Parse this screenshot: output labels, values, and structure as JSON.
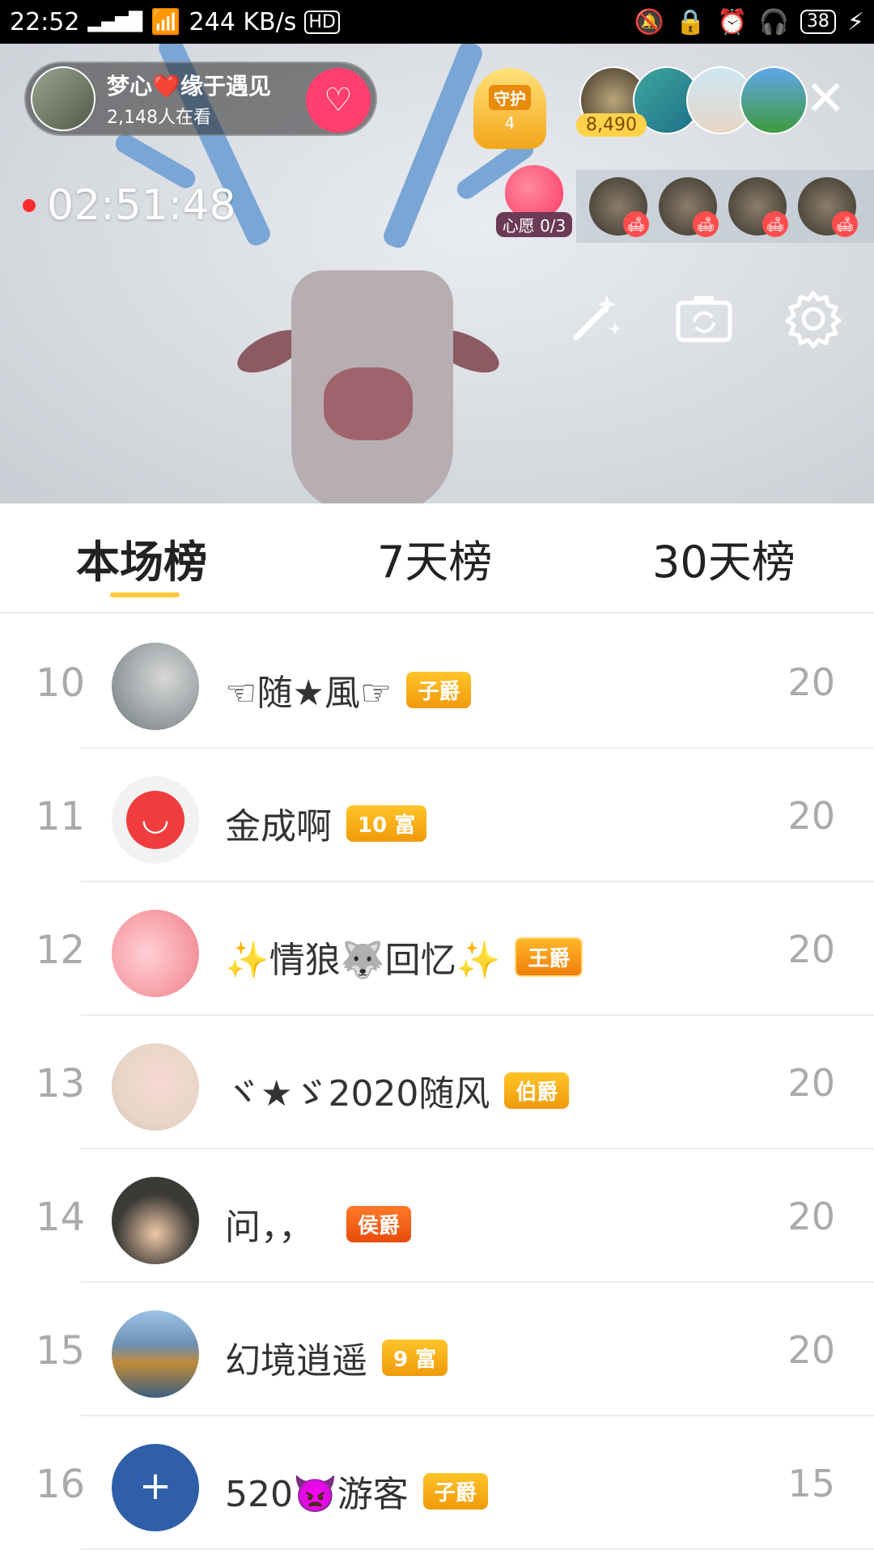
{
  "status_bar": {
    "time": "22:52",
    "network": "4G",
    "speed": "244 KB/s",
    "hd": "HD",
    "battery": "38"
  },
  "live": {
    "host_name": "梦心❤️缘于遇见",
    "viewers": "2,148人在看",
    "guard_label": "守护",
    "guard_count": "4",
    "audience_score": "8,490",
    "timer": "02:51:48",
    "wish_label": "心愿 0/3"
  },
  "tabs": [
    {
      "label": "本场榜",
      "active": true
    },
    {
      "label": "7天榜",
      "active": false
    },
    {
      "label": "30天榜",
      "active": false
    }
  ],
  "ranking": [
    {
      "rank": "10",
      "name": "☜随★風☞",
      "badge": "子爵",
      "score": "20",
      "avatar_color": "#6f7a7e"
    },
    {
      "rank": "11",
      "name": "金成啊",
      "badge": "10 富",
      "score": "20",
      "avatar_color": "#f03c3c"
    },
    {
      "rank": "12",
      "name": "✨情狼🐺回忆✨",
      "badge": "王爵",
      "score": "20",
      "avatar_color": "#f7a0a8"
    },
    {
      "rank": "13",
      "name": "ヾ★ゞ2020随风",
      "badge": "伯爵",
      "score": "20",
      "avatar_color": "#e8d6c8"
    },
    {
      "rank": "14",
      "name": "问，，",
      "badge": "侯爵",
      "score": "20",
      "avatar_color": "#3b3a36"
    },
    {
      "rank": "15",
      "name": "幻境逍遥",
      "badge": "9 富",
      "score": "20",
      "avatar_color": "#6d8fb0"
    },
    {
      "rank": "16",
      "name": "520👿游客",
      "badge": "子爵",
      "score": "15",
      "avatar_color": "#2f5fa8"
    }
  ],
  "colors": {
    "accent_yellow": "#ffc93a",
    "follow_pink": "#ff3f6e",
    "rank_gray": "#aaaaaa"
  }
}
